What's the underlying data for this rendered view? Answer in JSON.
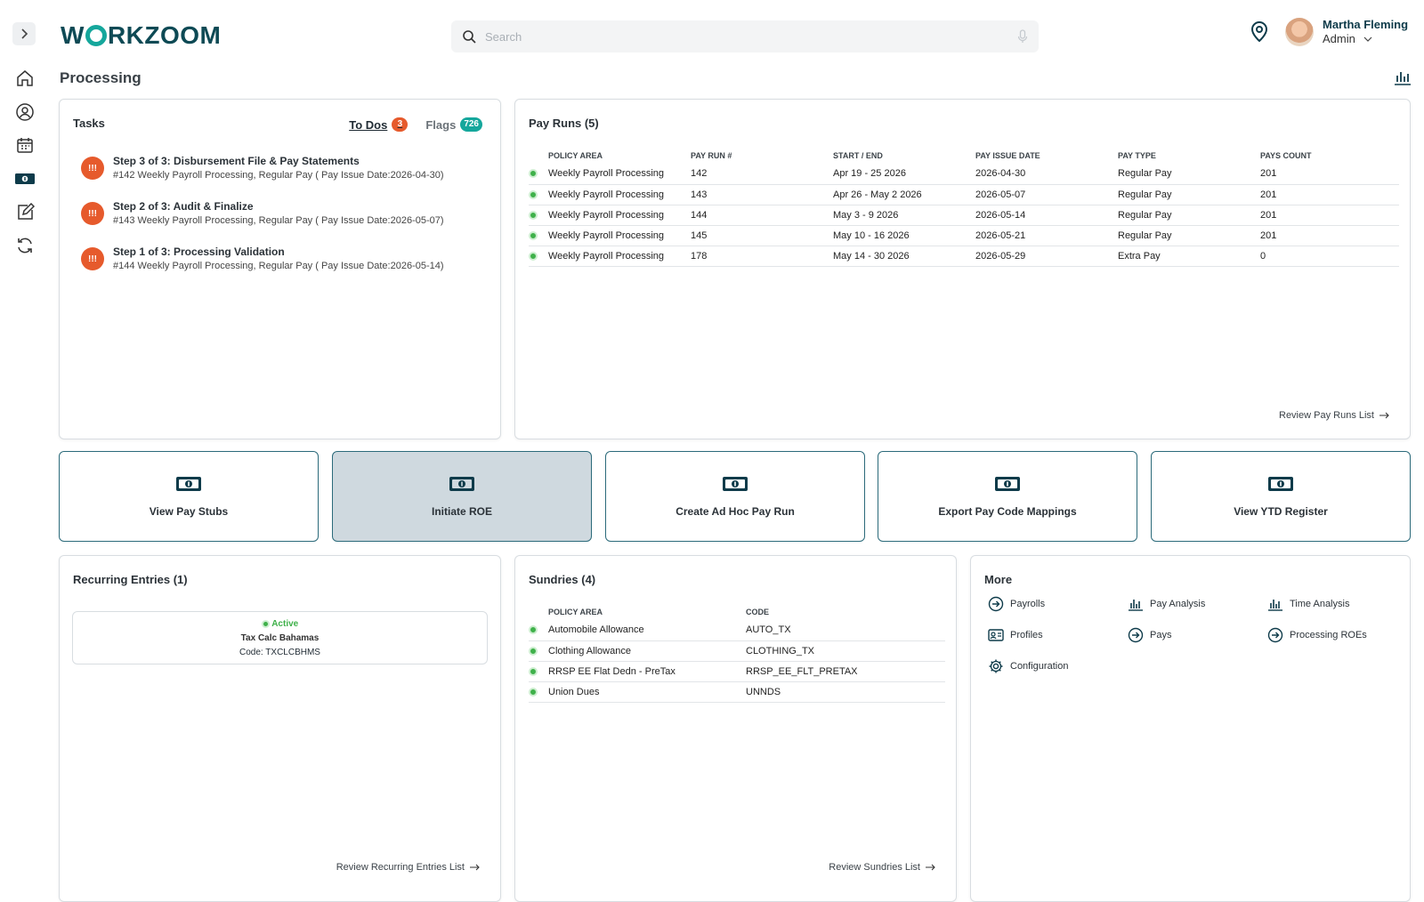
{
  "header": {
    "logo_text": "WORKZOOM",
    "search_placeholder": "Search",
    "user_name": "Martha Fleming",
    "user_role": "Admin"
  },
  "page_title": "Processing",
  "tasks": {
    "title": "Tasks",
    "todos_label": "To Dos",
    "todos_count": "3",
    "flags_label": "Flags",
    "flags_count": "726",
    "items": [
      {
        "title": "Step 3 of 3: Disbursement File & Pay Statements",
        "sub": "#142 Weekly Payroll Processing, Regular Pay ( Pay Issue Date:2026-04-30)"
      },
      {
        "title": "Step 2 of 3: Audit & Finalize",
        "sub": "#143 Weekly Payroll Processing, Regular Pay ( Pay Issue Date:2026-05-07)"
      },
      {
        "title": "Step 1 of 3: Processing Validation",
        "sub": "#144 Weekly Payroll Processing, Regular Pay ( Pay Issue Date:2026-05-14)"
      }
    ]
  },
  "pay_runs": {
    "title": "Pay Runs (5)",
    "columns": [
      "POLICY AREA",
      "PAY RUN #",
      "START / END",
      "PAY ISSUE DATE",
      "PAY TYPE",
      "PAYS COUNT"
    ],
    "rows": [
      [
        "Weekly Payroll Processing",
        "142",
        "Apr 19 - 25 2026",
        "2026-04-30",
        "Regular Pay",
        "201"
      ],
      [
        "Weekly Payroll Processing",
        "143",
        "Apr 26 - May 2 2026",
        "2026-05-07",
        "Regular Pay",
        "201"
      ],
      [
        "Weekly Payroll Processing",
        "144",
        "May 3 - 9 2026",
        "2026-05-14",
        "Regular Pay",
        "201"
      ],
      [
        "Weekly Payroll Processing",
        "145",
        "May 10 - 16 2026",
        "2026-05-21",
        "Regular Pay",
        "201"
      ],
      [
        "Weekly Payroll Processing",
        "178",
        "May 14 - 30 2026",
        "2026-05-29",
        "Extra Pay",
        "0"
      ]
    ],
    "link": "Review Pay Runs List"
  },
  "actions": [
    {
      "label": "View Pay Stubs"
    },
    {
      "label": "Initiate ROE"
    },
    {
      "label": "Create Ad Hoc Pay Run"
    },
    {
      "label": "Export Pay Code Mappings"
    },
    {
      "label": "View YTD Register"
    }
  ],
  "recurring": {
    "title": "Recurring Entries (1)",
    "status": "Active",
    "name": "Tax Calc Bahamas",
    "code": "Code: TXCLCBHMS",
    "link": "Review Recurring Entries List"
  },
  "sundries": {
    "title": "Sundries (4)",
    "columns": [
      "POLICY AREA",
      "CODE"
    ],
    "rows": [
      [
        "Automobile Allowance",
        "AUTO_TX"
      ],
      [
        "Clothing Allowance",
        "CLOTHING_TX"
      ],
      [
        "RRSP EE Flat Dedn - PreTax",
        "RRSP_EE_FLT_PRETAX"
      ],
      [
        "Union Dues",
        "UNNDS"
      ]
    ],
    "link": "Review Sundries List"
  },
  "more": {
    "title": "More",
    "items": [
      {
        "label": "Payrolls",
        "icon": "arrow-circle-icon"
      },
      {
        "label": "Pay Analysis",
        "icon": "bar-chart-icon"
      },
      {
        "label": "Time Analysis",
        "icon": "bar-chart-icon"
      },
      {
        "label": "Profiles",
        "icon": "id-card-icon"
      },
      {
        "label": "Pays",
        "icon": "arrow-circle-icon"
      },
      {
        "label": "Processing ROEs",
        "icon": "arrow-circle-icon"
      },
      {
        "label": "Configuration",
        "icon": "gear-icon"
      }
    ]
  },
  "colors": {
    "brand": "#0e4a55",
    "accent": "#15a79c",
    "todo_badge": "#e65a2c",
    "flag_badge": "#15a79c",
    "status_green": "#3fb14a"
  }
}
